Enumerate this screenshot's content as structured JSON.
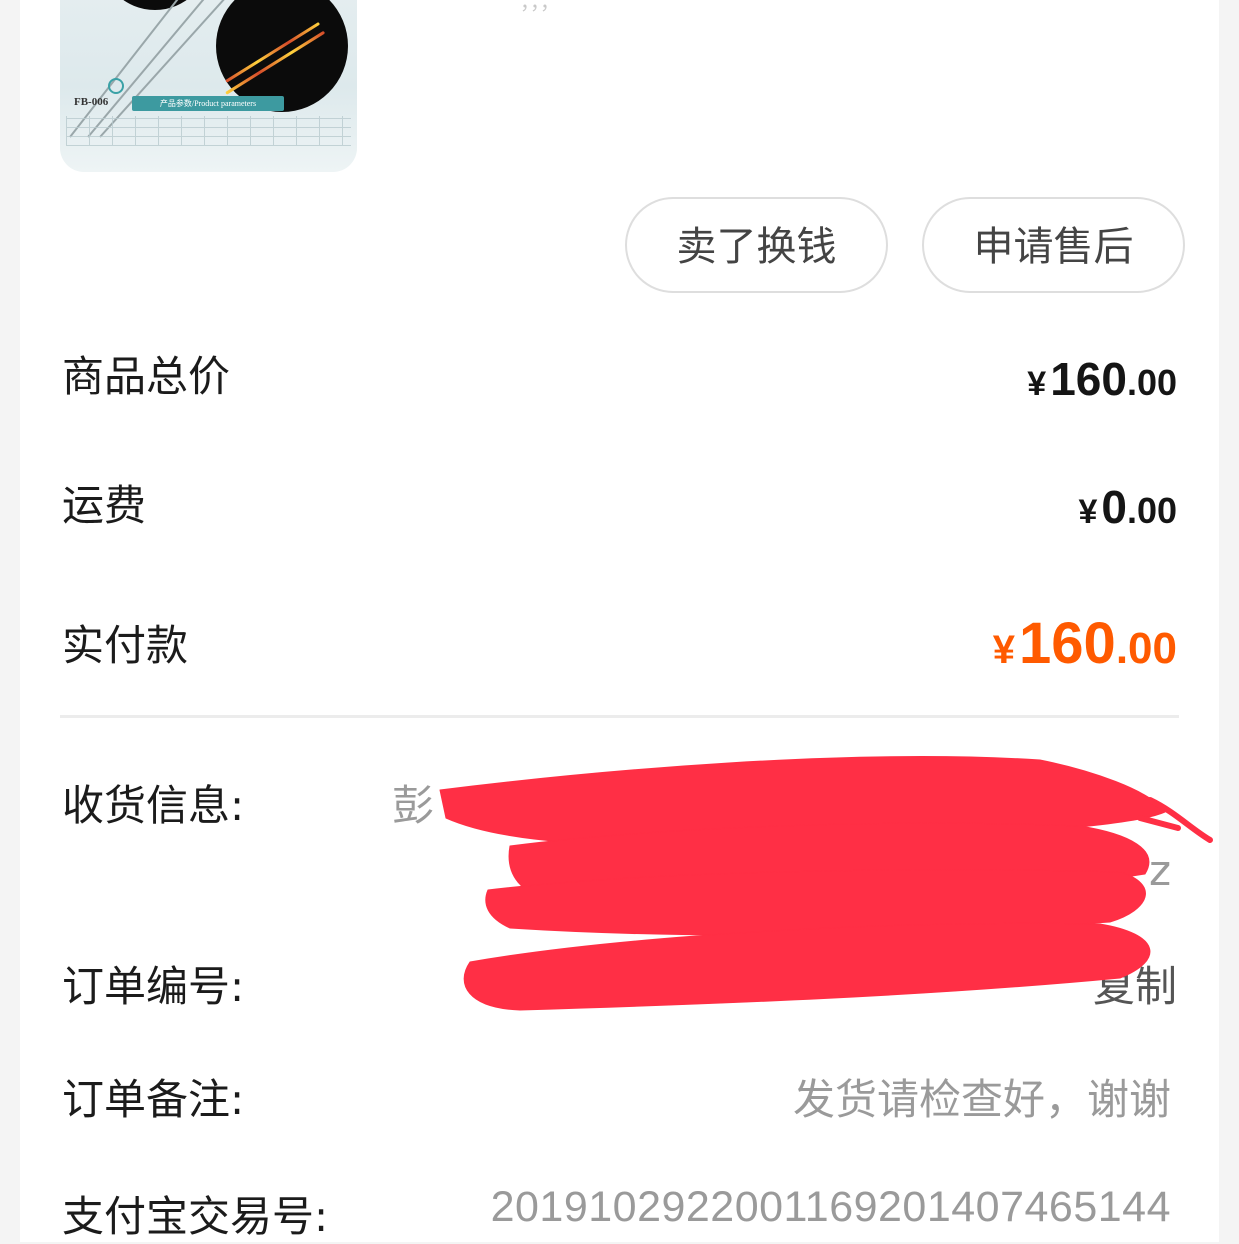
{
  "product": {
    "thumbnail": {
      "model_code": "FB-006",
      "param_tag": "产品参数/Product parameters"
    },
    "top_fragment": "，，，"
  },
  "actions": {
    "sell_label": "卖了换钱",
    "aftersale_label": "申请售后"
  },
  "summary": {
    "goods_total": {
      "label": "商品总价",
      "currency": "¥",
      "integer": "160",
      "decimal": ".00"
    },
    "shipping": {
      "label": "运费",
      "currency": "¥",
      "integer": "0",
      "decimal": ".00"
    },
    "paid": {
      "label": "实付款",
      "currency": "¥",
      "integer": "160",
      "decimal": ".00"
    }
  },
  "order_info": {
    "shipping_info": {
      "label": "收货信息:",
      "value_visible_start": "彭",
      "value_visible_end": "z"
    },
    "order_number": {
      "label": "订单编号:",
      "copy_label": "复制"
    },
    "order_note": {
      "label": "订单备注:",
      "value": "发货请检查好，谢谢"
    },
    "alipay_trade_no": {
      "label": "支付宝交易号:",
      "value": "2019102922001169201407465144"
    }
  },
  "colors": {
    "accent_paid": "#ff5a00",
    "redaction": "#ff2f45",
    "secondary_text": "#9a9a9a"
  }
}
